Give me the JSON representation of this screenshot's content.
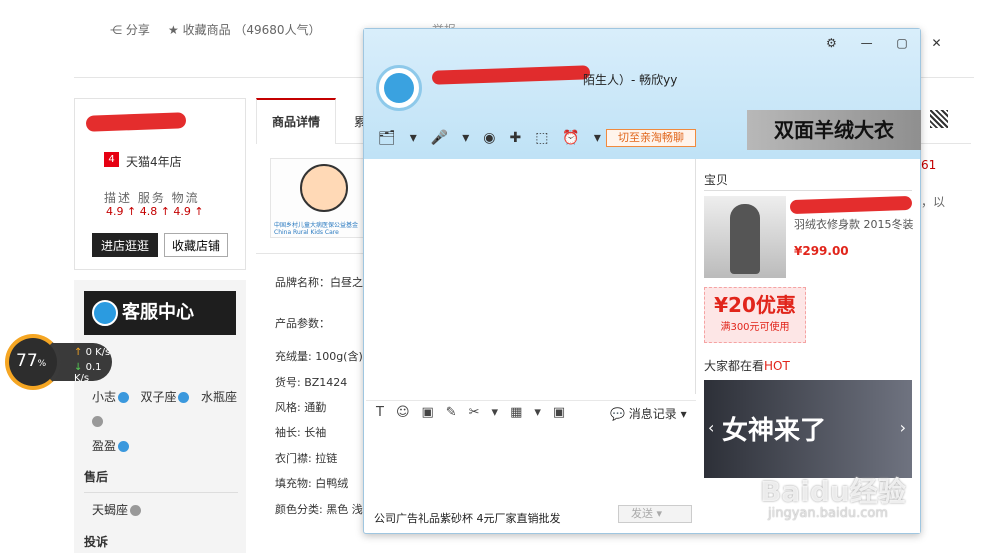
{
  "page": {
    "share": "分享",
    "favorite": "收藏商品 （49680人气）",
    "report": "举报",
    "shop": {
      "tmall_badge": "4",
      "tmall_years": "天猫4年店",
      "rating_labels": "描述  服务  物流",
      "rating_values": "4.9 ↑  4.8 ↑  4.9 ↑",
      "enter_btn": "进店逛逛",
      "collect_btn": "收藏店铺"
    },
    "service": {
      "banner": "客服中心",
      "agents": [
        "小志",
        "双子座",
        "水瓶座",
        "盈盈"
      ],
      "aftersale_heading": "售后",
      "aftersale_agent": "天蝎座",
      "complaint_heading": "投诉"
    },
    "tabs": {
      "detail": "商品详情",
      "second": "累"
    },
    "charity_text": "中国乡村儿童大病医保公益基金 China Rural Kids Care",
    "params": {
      "brand": "品牌名称：白昼之",
      "title": "产品参数：",
      "items": [
        "充绒量: 100g(含)-",
        "货号: BZ1424",
        "风格: 通勤",
        "袖长: 长袖",
        "衣门襟: 拉链",
        "填充物: 白鸭绒",
        "颜色分类: 黑色 浅"
      ]
    },
    "right_a": "61",
    "right_b": "，以"
  },
  "speed": {
    "percent": "77",
    "unit": "%",
    "up": "0 K/s",
    "down": "0.1 K/s"
  },
  "chat": {
    "contact_tail": "陌生人）- 畅欣yy",
    "window_controls": "⚙ — ▢ ✕",
    "toolbar_icons": "🗂▾🎤▾◉✚⬚⏰▾",
    "switch_btn": "切至亲淘畅聊",
    "ad_banner": "双面羊绒大衣",
    "input_icons": "T☺▣✎✂▾▦▾▣",
    "history": "💬 消息记录  ▾",
    "footer_ad": "公司广告礼品紫砂杯 4元厂家直销批发",
    "send": "发送  ▾",
    "baobei_title": "宝贝",
    "baobei_desc": "羽绒衣修身款 2015冬装",
    "baobei_price": "¥299.00",
    "coupon_amount": "¥20优惠",
    "coupon_cond": "满300元可使用",
    "hot_prefix": "大家都在看",
    "hot_suffix": "HOT",
    "hot_text": "女神来了",
    "watermark": "Baidu经验",
    "watermark_sub": "jingyan.baidu.com"
  }
}
